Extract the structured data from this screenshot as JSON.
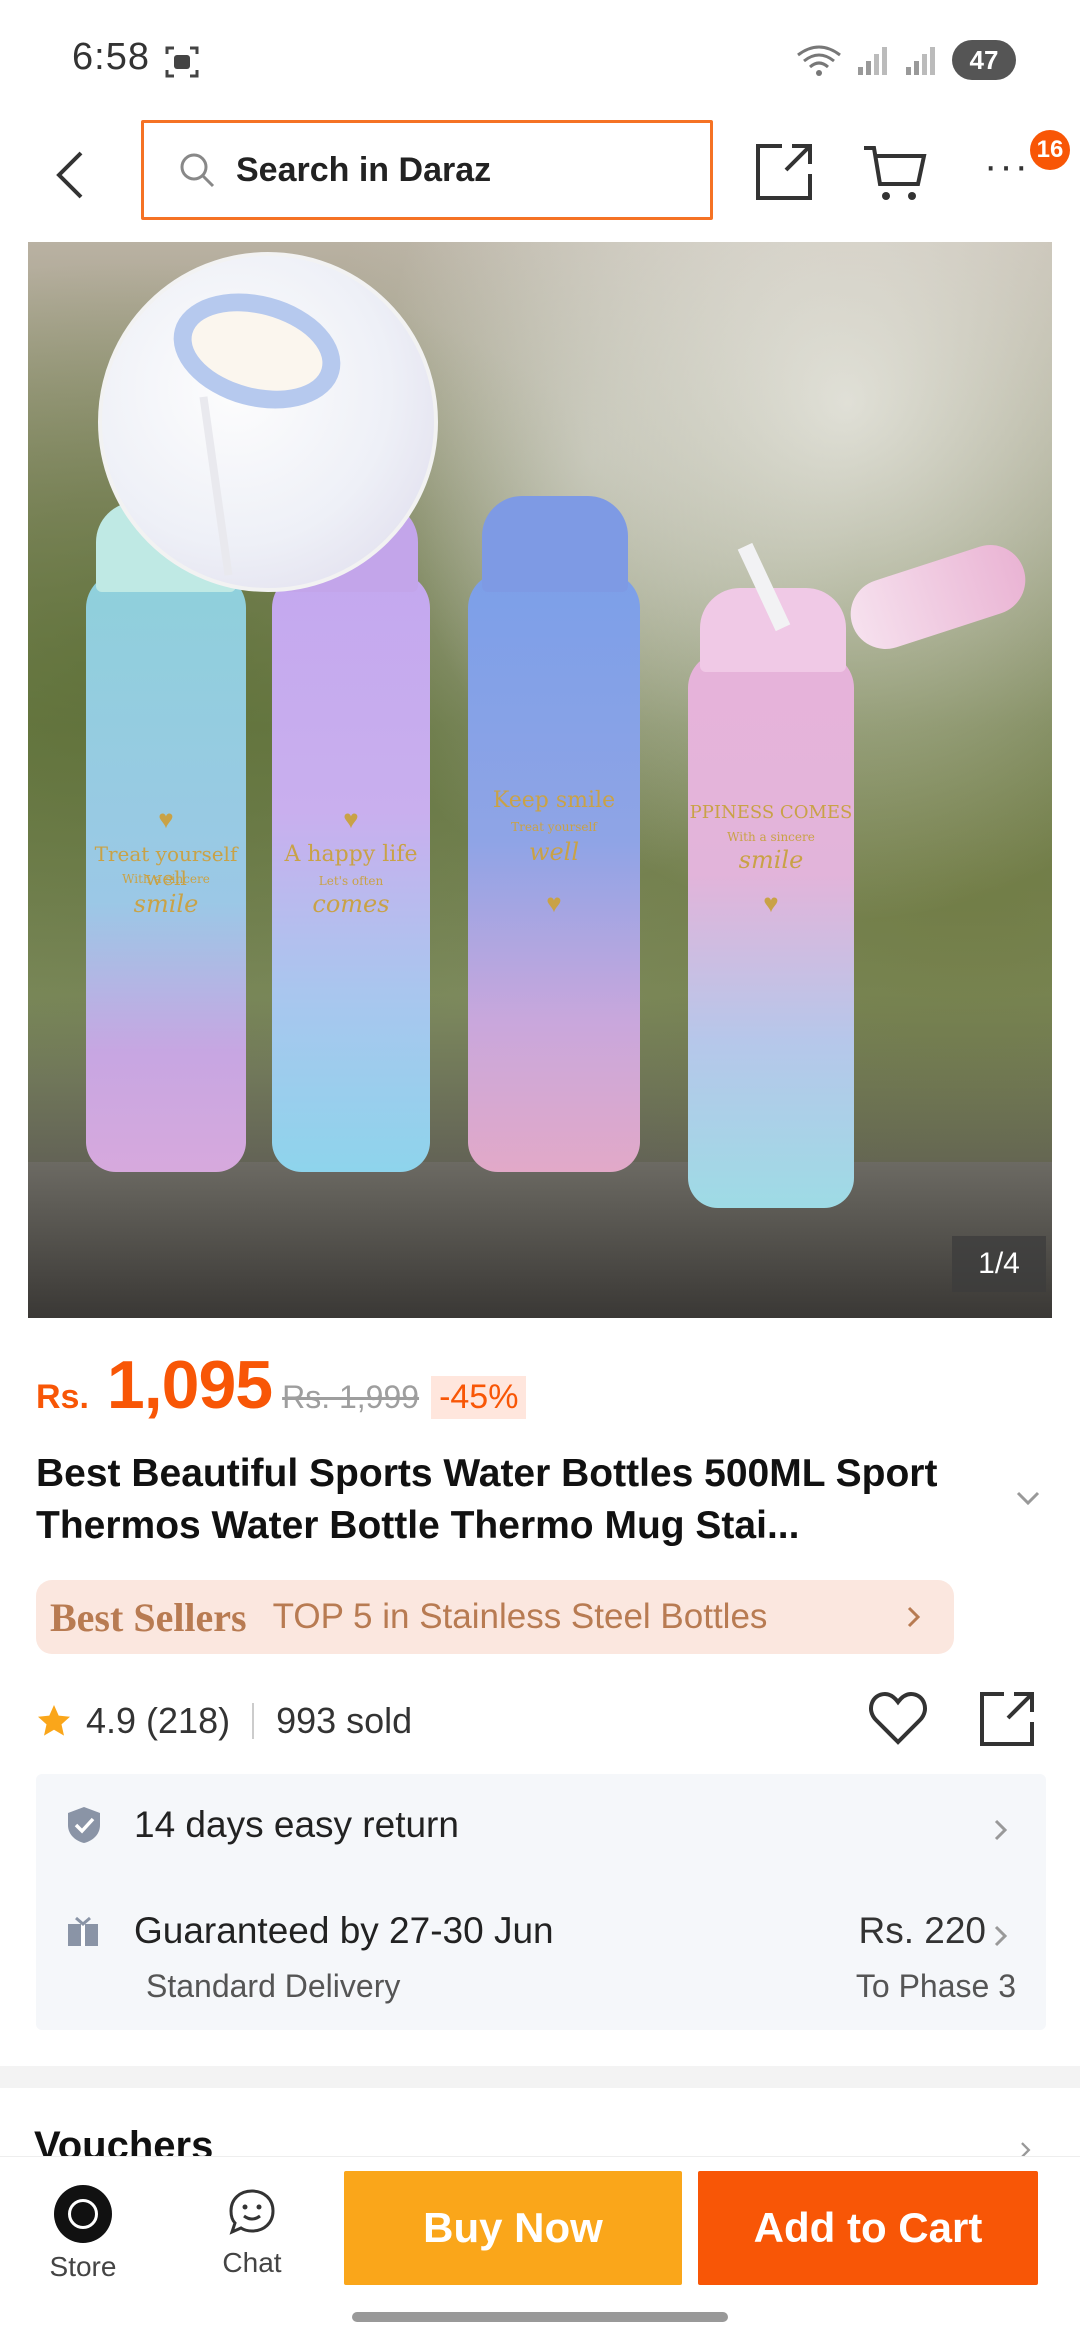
{
  "status_bar": {
    "time": "6:58",
    "battery": "47"
  },
  "search": {
    "placeholder": "Search in Daraz"
  },
  "nav": {
    "more_glyph": "···",
    "badge": "16"
  },
  "image": {
    "counter": "1/4",
    "bottle_texts": [
      {
        "line1": "Treat yourself well",
        "line2": "With a sincere",
        "line3": "smile"
      },
      {
        "line1": "A happy life",
        "line2": "Let's often",
        "line3": "comes"
      },
      {
        "line1": "Keep smile",
        "line2": "Treat yourself",
        "line3": "well"
      },
      {
        "line1": "PPINESS COMES",
        "line2": "With a sincere",
        "line3": "smile"
      }
    ]
  },
  "price": {
    "currency": "Rs.",
    "value": "1,095",
    "original": "Rs. 1,999",
    "discount": "-45%"
  },
  "product": {
    "title": "Best Beautiful Sports Water Bottles 500ML Sport Thermos Water Bottle Thermo Mug Stai..."
  },
  "best_sellers": {
    "logo": "Best Sellers",
    "text": "TOP 5 in Stainless Steel Bottles"
  },
  "rating": {
    "score": "4.9",
    "count": "(218)",
    "sold": "993 sold"
  },
  "return": {
    "text": "14 days easy return"
  },
  "delivery": {
    "text": "Guaranteed by 27-30 Jun",
    "method": "Standard Delivery",
    "fee": "Rs. 220",
    "phase": "To Phase 3"
  },
  "vouchers": {
    "title": "Vouchers"
  },
  "bottom": {
    "store_label": "Store",
    "chat_label": "Chat",
    "buy_now": "Buy Now",
    "add_to_cart": "Add to Cart"
  },
  "colors": {
    "accent": "#f85606",
    "search_border": "#f57224",
    "buy_now": "#faa61a",
    "add_to_cart": "#f85606"
  }
}
